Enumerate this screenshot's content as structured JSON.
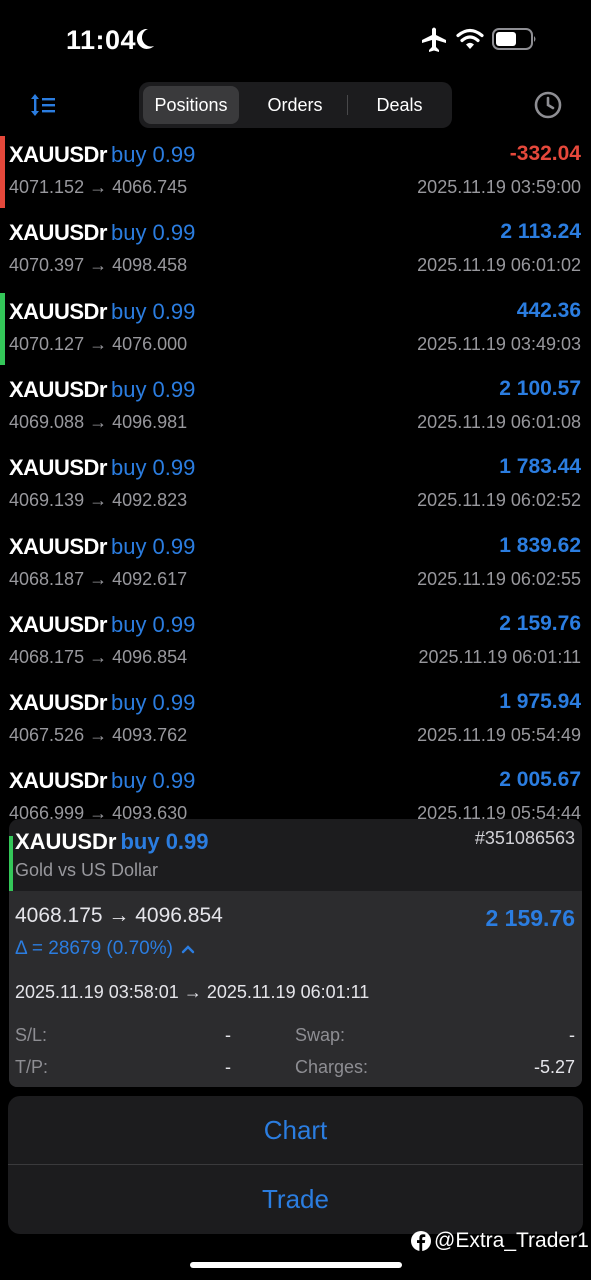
{
  "status": {
    "time": "11:04",
    "icons": [
      "moon-icon",
      "airplane-icon",
      "wifi-icon",
      "battery-icon"
    ]
  },
  "toolbar": {
    "tabs": [
      {
        "label": "Positions",
        "active": true
      },
      {
        "label": "Orders",
        "active": false
      },
      {
        "label": "Deals",
        "active": false
      }
    ],
    "icons": [
      "sort-icon",
      "history-icon"
    ]
  },
  "colors": {
    "accent_blue": "#2b7de0",
    "loss_red": "#e5483b",
    "marker_green": "#34c759",
    "background": "#000000"
  },
  "positions": [
    {
      "symbol": "XAUUSDr",
      "side": "buy 0.99",
      "prices": "4071.152 → 4066.745",
      "profit": "-332.04",
      "time": "2025.11.19 03:59:00",
      "marker": "red"
    },
    {
      "symbol": "XAUUSDr",
      "side": "buy 0.99",
      "prices": "4070.397 → 4098.458",
      "profit": "2 113.24",
      "time": "2025.11.19 06:01:02",
      "marker": "none"
    },
    {
      "symbol": "XAUUSDr",
      "side": "buy 0.99",
      "prices": "4070.127 → 4076.000",
      "profit": "442.36",
      "time": "2025.11.19 03:49:03",
      "marker": "green"
    },
    {
      "symbol": "XAUUSDr",
      "side": "buy 0.99",
      "prices": "4069.088 → 4096.981",
      "profit": "2 100.57",
      "time": "2025.11.19 06:01:08",
      "marker": "none"
    },
    {
      "symbol": "XAUUSDr",
      "side": "buy 0.99",
      "prices": "4069.139 → 4092.823",
      "profit": "1 783.44",
      "time": "2025.11.19 06:02:52",
      "marker": "none"
    },
    {
      "symbol": "XAUUSDr",
      "side": "buy 0.99",
      "prices": "4068.187 → 4092.617",
      "profit": "1 839.62",
      "time": "2025.11.19 06:02:55",
      "marker": "none"
    },
    {
      "symbol": "XAUUSDr",
      "side": "buy 0.99",
      "prices": "4068.175 → 4096.854",
      "profit": "2 159.76",
      "time": "2025.11.19 06:01:11",
      "marker": "none"
    },
    {
      "symbol": "XAUUSDr",
      "side": "buy 0.99",
      "prices": "4067.526 → 4093.762",
      "profit": "1 975.94",
      "time": "2025.11.19 05:54:49",
      "marker": "none"
    },
    {
      "symbol": "XAUUSDr",
      "side": "buy 0.99",
      "prices": "4066.999 → 4093.630",
      "profit": "2 005.67",
      "time": "2025.11.19 05:54:44",
      "marker": "none"
    }
  ],
  "detail": {
    "symbol": "XAUUSDr",
    "side": "buy 0.99",
    "ticket": "#351086563",
    "description": "Gold vs US Dollar",
    "prices": "4068.175 → 4096.854",
    "profit": "2 159.76",
    "delta": "Δ = 28679 (0.70%)",
    "times": "2025.11.19 03:58:01 → 2025.11.19 06:01:11",
    "sl_label": "S/L:",
    "sl_value": "-",
    "tp_label": "T/P:",
    "tp_value": "-",
    "swap_label": "Swap:",
    "swap_value": "-",
    "charges_label": "Charges:",
    "charges_value": "-5.27"
  },
  "actions": {
    "chart": "Chart",
    "trade": "Trade"
  },
  "watermark": {
    "icon": "facebook-icon",
    "text": "@Extra_Trader1"
  }
}
